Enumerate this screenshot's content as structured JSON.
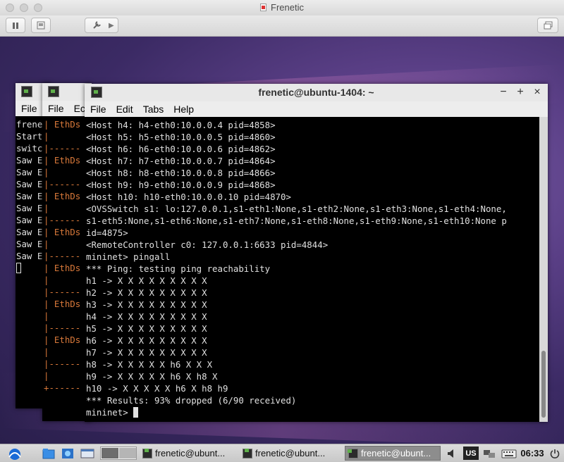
{
  "vm": {
    "title": "Frenetic"
  },
  "left_window": {
    "menu": [
      "File"
    ],
    "lines": [
      "frene",
      "Start",
      "switc",
      "Saw E",
      "Saw E",
      "Saw E",
      "Saw E",
      "Saw E",
      "Saw E",
      "Saw E",
      "Saw E",
      "Saw E"
    ]
  },
  "mid_window": {
    "menu": [
      "File",
      "Ec"
    ],
    "lines": [
      "| EthDs",
      "|",
      "|------",
      "| EthDs",
      "|",
      "|------",
      "| EthDs",
      "|",
      "|------",
      "| EthDs",
      "|",
      "|------",
      "| EthDs",
      "|",
      "|------",
      "| EthDs",
      "|",
      "|------",
      "| EthDs",
      "|",
      "|------",
      "|",
      "+------"
    ]
  },
  "main_window": {
    "title": "frenetic@ubuntu-1404: ~",
    "menu": [
      "File",
      "Edit",
      "Tabs",
      "Help"
    ],
    "lines": [
      "<Host h4: h4-eth0:10.0.0.4 pid=4858>",
      "<Host h5: h5-eth0:10.0.0.5 pid=4860>",
      "<Host h6: h6-eth0:10.0.0.6 pid=4862>",
      "<Host h7: h7-eth0:10.0.0.7 pid=4864>",
      "<Host h8: h8-eth0:10.0.0.8 pid=4866>",
      "<Host h9: h9-eth0:10.0.0.9 pid=4868>",
      "<Host h10: h10-eth0:10.0.0.10 pid=4870>",
      "<OVSSwitch s1: lo:127.0.0.1,s1-eth1:None,s1-eth2:None,s1-eth3:None,s1-eth4:None,",
      "s1-eth5:None,s1-eth6:None,s1-eth7:None,s1-eth8:None,s1-eth9:None,s1-eth10:None p",
      "id=4875>",
      "<RemoteController c0: 127.0.0.1:6633 pid=4844>",
      "mininet> pingall",
      "*** Ping: testing ping reachability",
      "h1 -> X X X X X X X X X",
      "h2 -> X X X X X X X X X",
      "h3 -> X X X X X X X X X",
      "h4 -> X X X X X X X X X",
      "h5 -> X X X X X X X X X",
      "h6 -> X X X X X X X X X",
      "h7 -> X X X X X X X X X",
      "h8 -> X X X X X h6 X X X",
      "h9 -> X X X X X h6 X h8 X",
      "h10 -> X X X X X h6 X h8 h9",
      "*** Results: 93% dropped (6/90 received)"
    ],
    "prompt": "mininet> "
  },
  "taskbar": {
    "tasks": [
      "frenetic@ubunt...",
      "frenetic@ubunt...",
      "frenetic@ubunt..."
    ],
    "keyboard_layout": "US",
    "clock": "06:33"
  }
}
